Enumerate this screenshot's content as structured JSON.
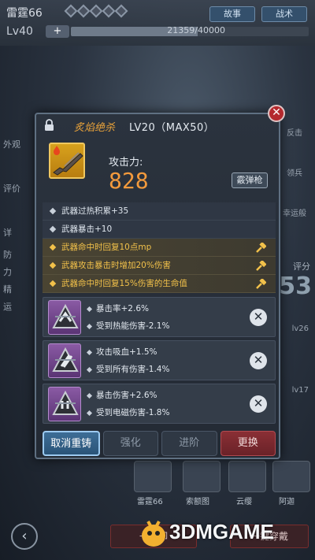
{
  "hud": {
    "character_name": "雷霆66",
    "level": "Lv40",
    "plus": "+",
    "exp_text": "21359/40000",
    "exp_fraction": 0.534,
    "tab_story": "故事",
    "tab_tactics": "战术"
  },
  "background": {
    "left_labels": [
      "外观",
      "评价",
      "详",
      "防",
      "力",
      "精",
      "运"
    ],
    "right_labels": [
      "反击",
      "领兵",
      "幸运般"
    ],
    "score_label": "评分",
    "score_value": "53",
    "level_badges": [
      "lv26",
      "lv17"
    ],
    "portraits": [
      {
        "name": "雷霆66"
      },
      {
        "name": "索额图"
      },
      {
        "name": "云缨"
      },
      {
        "name": "阿迦"
      }
    ],
    "bottom_left_button": "一键卸",
    "bottom_right_button": "一键穿戴"
  },
  "modal": {
    "weapon_name": "炙焰绝杀",
    "weapon_level": "LV20（MAX50）",
    "attack_label": "攻击力:",
    "attack_value": "828",
    "weapon_type": "霰弹枪",
    "base_stats": [
      "武器过热积累+35",
      "武器暴击+10"
    ],
    "special_stats": [
      "武器命中时回复10点mp",
      "武器攻击暴击时增加20%伤害",
      "武器命中时回复15%伤害的生命值"
    ],
    "reforges": [
      {
        "line1": "暴击率+2.6%",
        "line2": "受到热能伤害-2.1%"
      },
      {
        "line1": "攻击吸血+1.5%",
        "line2": "受到所有伤害-1.4%"
      },
      {
        "line1": "暴击伤害+2.6%",
        "line2": "受到电磁伤害-1.8%"
      }
    ],
    "actions": {
      "cancel_reforge": "取消重铸",
      "enhance": "强化",
      "advance": "进阶",
      "replace": "更换"
    },
    "close": "✕"
  },
  "watermark": "3DMGAME",
  "colors": {
    "weapon_name": "#e8a23a",
    "attack_value": "#f39a3c",
    "special_stat": "#f2c14a",
    "primary_button": "#2a5478",
    "replace_button": "#6a2228"
  }
}
